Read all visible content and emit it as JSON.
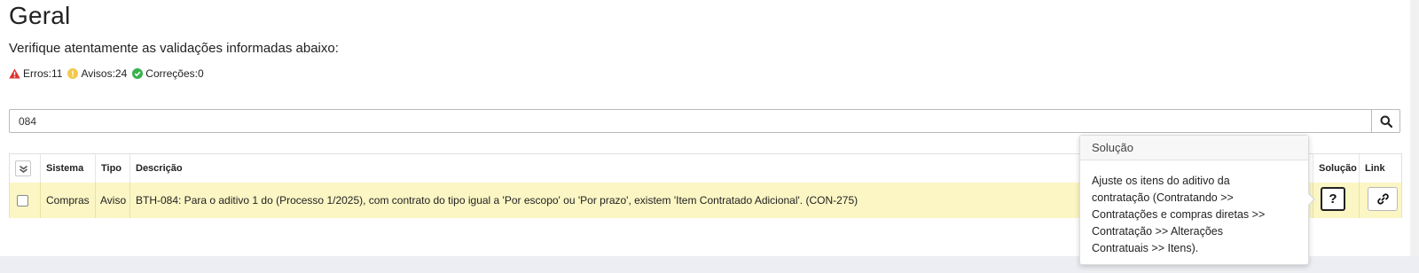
{
  "page": {
    "title": "Geral",
    "subtitle": "Verifique atentamente as validações informadas abaixo:"
  },
  "stats": {
    "errors_label": "Erros:11",
    "warnings_label": "Avisos:24",
    "corrections_label": "Correções:0",
    "colors": {
      "error": "#e03131",
      "warning": "#f2c94c",
      "correction": "#37b24d"
    }
  },
  "search": {
    "value": "084",
    "icon": "search-icon"
  },
  "table": {
    "headers": {
      "select_all_icon": "double-check-icon",
      "sistema": "Sistema",
      "tipo": "Tipo",
      "descricao": "Descrição",
      "solucao": "Solução",
      "link": "Link"
    },
    "rows": [
      {
        "sistema": "Compras",
        "tipo": "Aviso",
        "descricao": "BTH-084: Para o aditivo 1 do (Processo 1/2025), com contrato do tipo igual a 'Por escopo' ou 'Por prazo', existem 'Item Contratado Adicional'. (CON-275)",
        "solution_button": "?",
        "link_icon": "link-icon",
        "highlight_color": "#fbf6c4"
      }
    ]
  },
  "popover": {
    "title": "Solução",
    "lines": [
      "Ajuste os itens do aditivo da",
      "contratação (Contratando >>",
      "Contratações e compras diretas >>",
      "Contratação >> Alterações",
      "Contratuais >> Itens)."
    ]
  }
}
